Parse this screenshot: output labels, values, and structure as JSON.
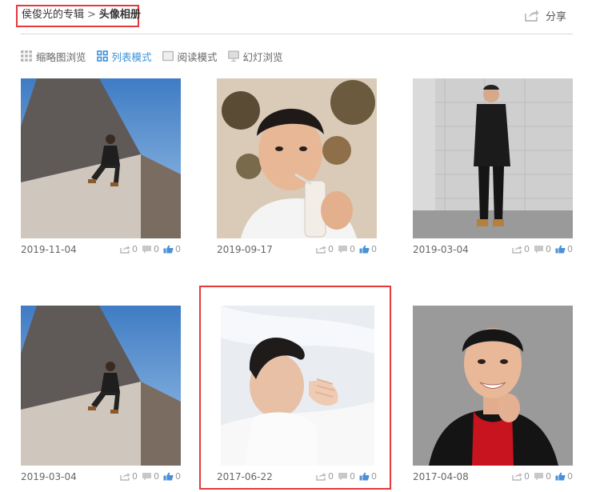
{
  "breadcrumb": {
    "parent": "侯俊光的专辑",
    "separator": ">",
    "current": "头像相册"
  },
  "share": {
    "label": "分享",
    "icon": "share-icon"
  },
  "view_modes": [
    {
      "label": "缩略图浏览",
      "icon": "grid-icon",
      "active": false
    },
    {
      "label": "列表模式",
      "icon": "list-grid-icon",
      "active": true
    },
    {
      "label": "阅读模式",
      "icon": "reader-icon",
      "active": false
    },
    {
      "label": "幻灯浏览",
      "icon": "slideshow-icon",
      "active": false
    }
  ],
  "photos": [
    {
      "date": "2019-11-04",
      "shares": "0",
      "comments": "0",
      "likes": "0"
    },
    {
      "date": "2019-09-17",
      "shares": "0",
      "comments": "0",
      "likes": "0"
    },
    {
      "date": "2019-03-04",
      "shares": "0",
      "comments": "0",
      "likes": "0"
    },
    {
      "date": "2019-03-04",
      "shares": "0",
      "comments": "0",
      "likes": "0"
    },
    {
      "date": "2017-06-22",
      "shares": "0",
      "comments": "0",
      "likes": "0"
    },
    {
      "date": "2017-04-08",
      "shares": "0",
      "comments": "0",
      "likes": "0"
    }
  ],
  "colors": {
    "accent_red": "#e4393c",
    "active_blue": "#3a8fd6",
    "like_blue": "#4a90d9"
  }
}
